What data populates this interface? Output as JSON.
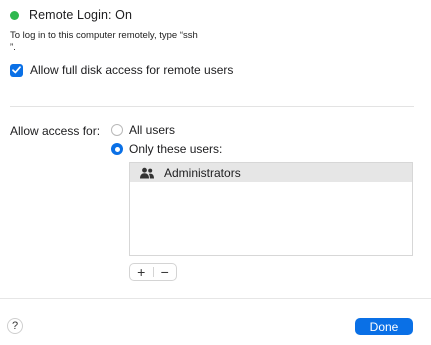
{
  "status": {
    "text": "Remote Login: On",
    "color": "#2fb84f"
  },
  "instructions": {
    "line1": "To log in to this computer remotely, type “ssh",
    "line2": "”."
  },
  "full_disk": {
    "label": "Allow full disk access for remote users",
    "checked": true
  },
  "access": {
    "label": "Allow access for:",
    "options": [
      {
        "label": "All users",
        "selected": false
      },
      {
        "label": "Only these users:",
        "selected": true
      }
    ]
  },
  "users": {
    "items": [
      {
        "label": "Administrators",
        "icon": "group-icon",
        "selected": true
      }
    ],
    "add_label": "+",
    "remove_label": "−"
  },
  "footer": {
    "help_label": "?",
    "done_label": "Done"
  },
  "colors": {
    "accent": "#0a70e6",
    "status_green": "#2fb84f"
  }
}
